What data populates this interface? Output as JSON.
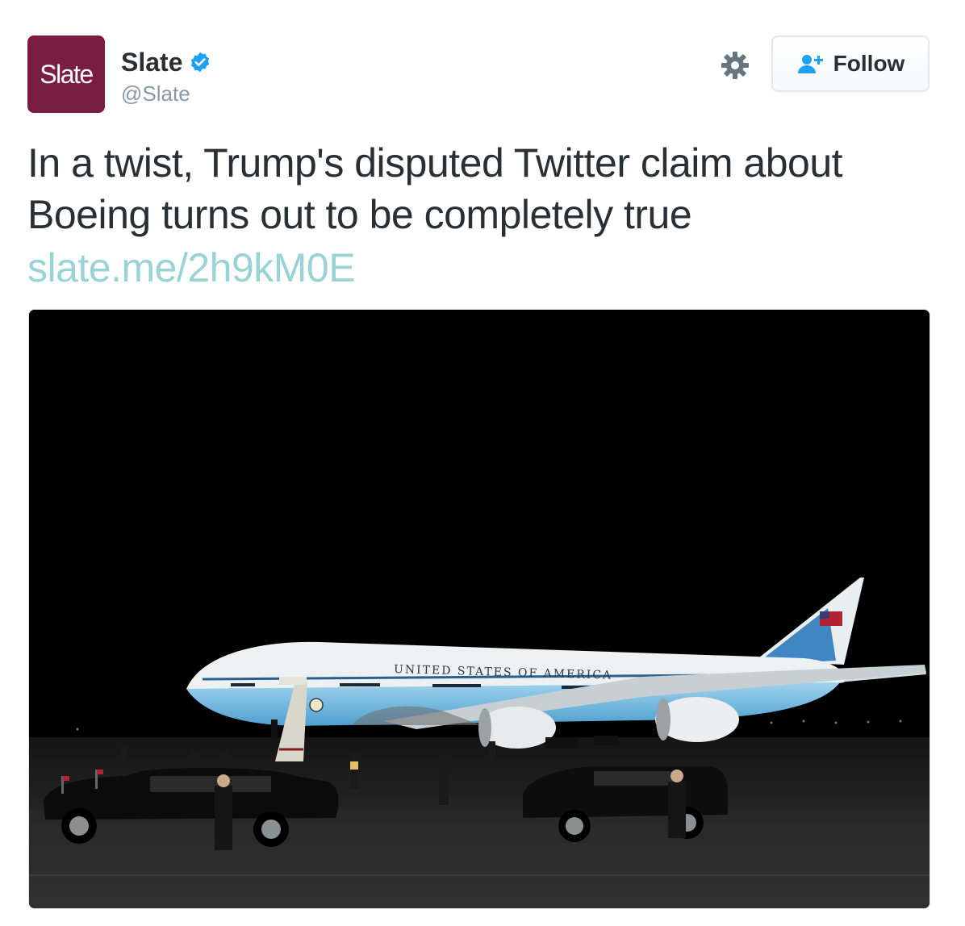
{
  "tweet": {
    "avatar_text": "Slate",
    "display_name": "Slate",
    "handle": "@Slate",
    "follow_label": "Follow",
    "text": "In a twist, Trump's disputed Twitter claim about Boeing turns out to be completely true",
    "link": "slate.me/2h9kM0E",
    "media": {
      "plane_text": "UNITED STATES OF AMERICA"
    }
  },
  "colors": {
    "brand": "#7a1d44",
    "verified": "#1da1f2",
    "link": "#99d3d6",
    "text": "#292f33",
    "muted": "#8899a6"
  },
  "icons": [
    "verified-badge-icon",
    "gear-icon",
    "follow-person-plus-icon"
  ]
}
